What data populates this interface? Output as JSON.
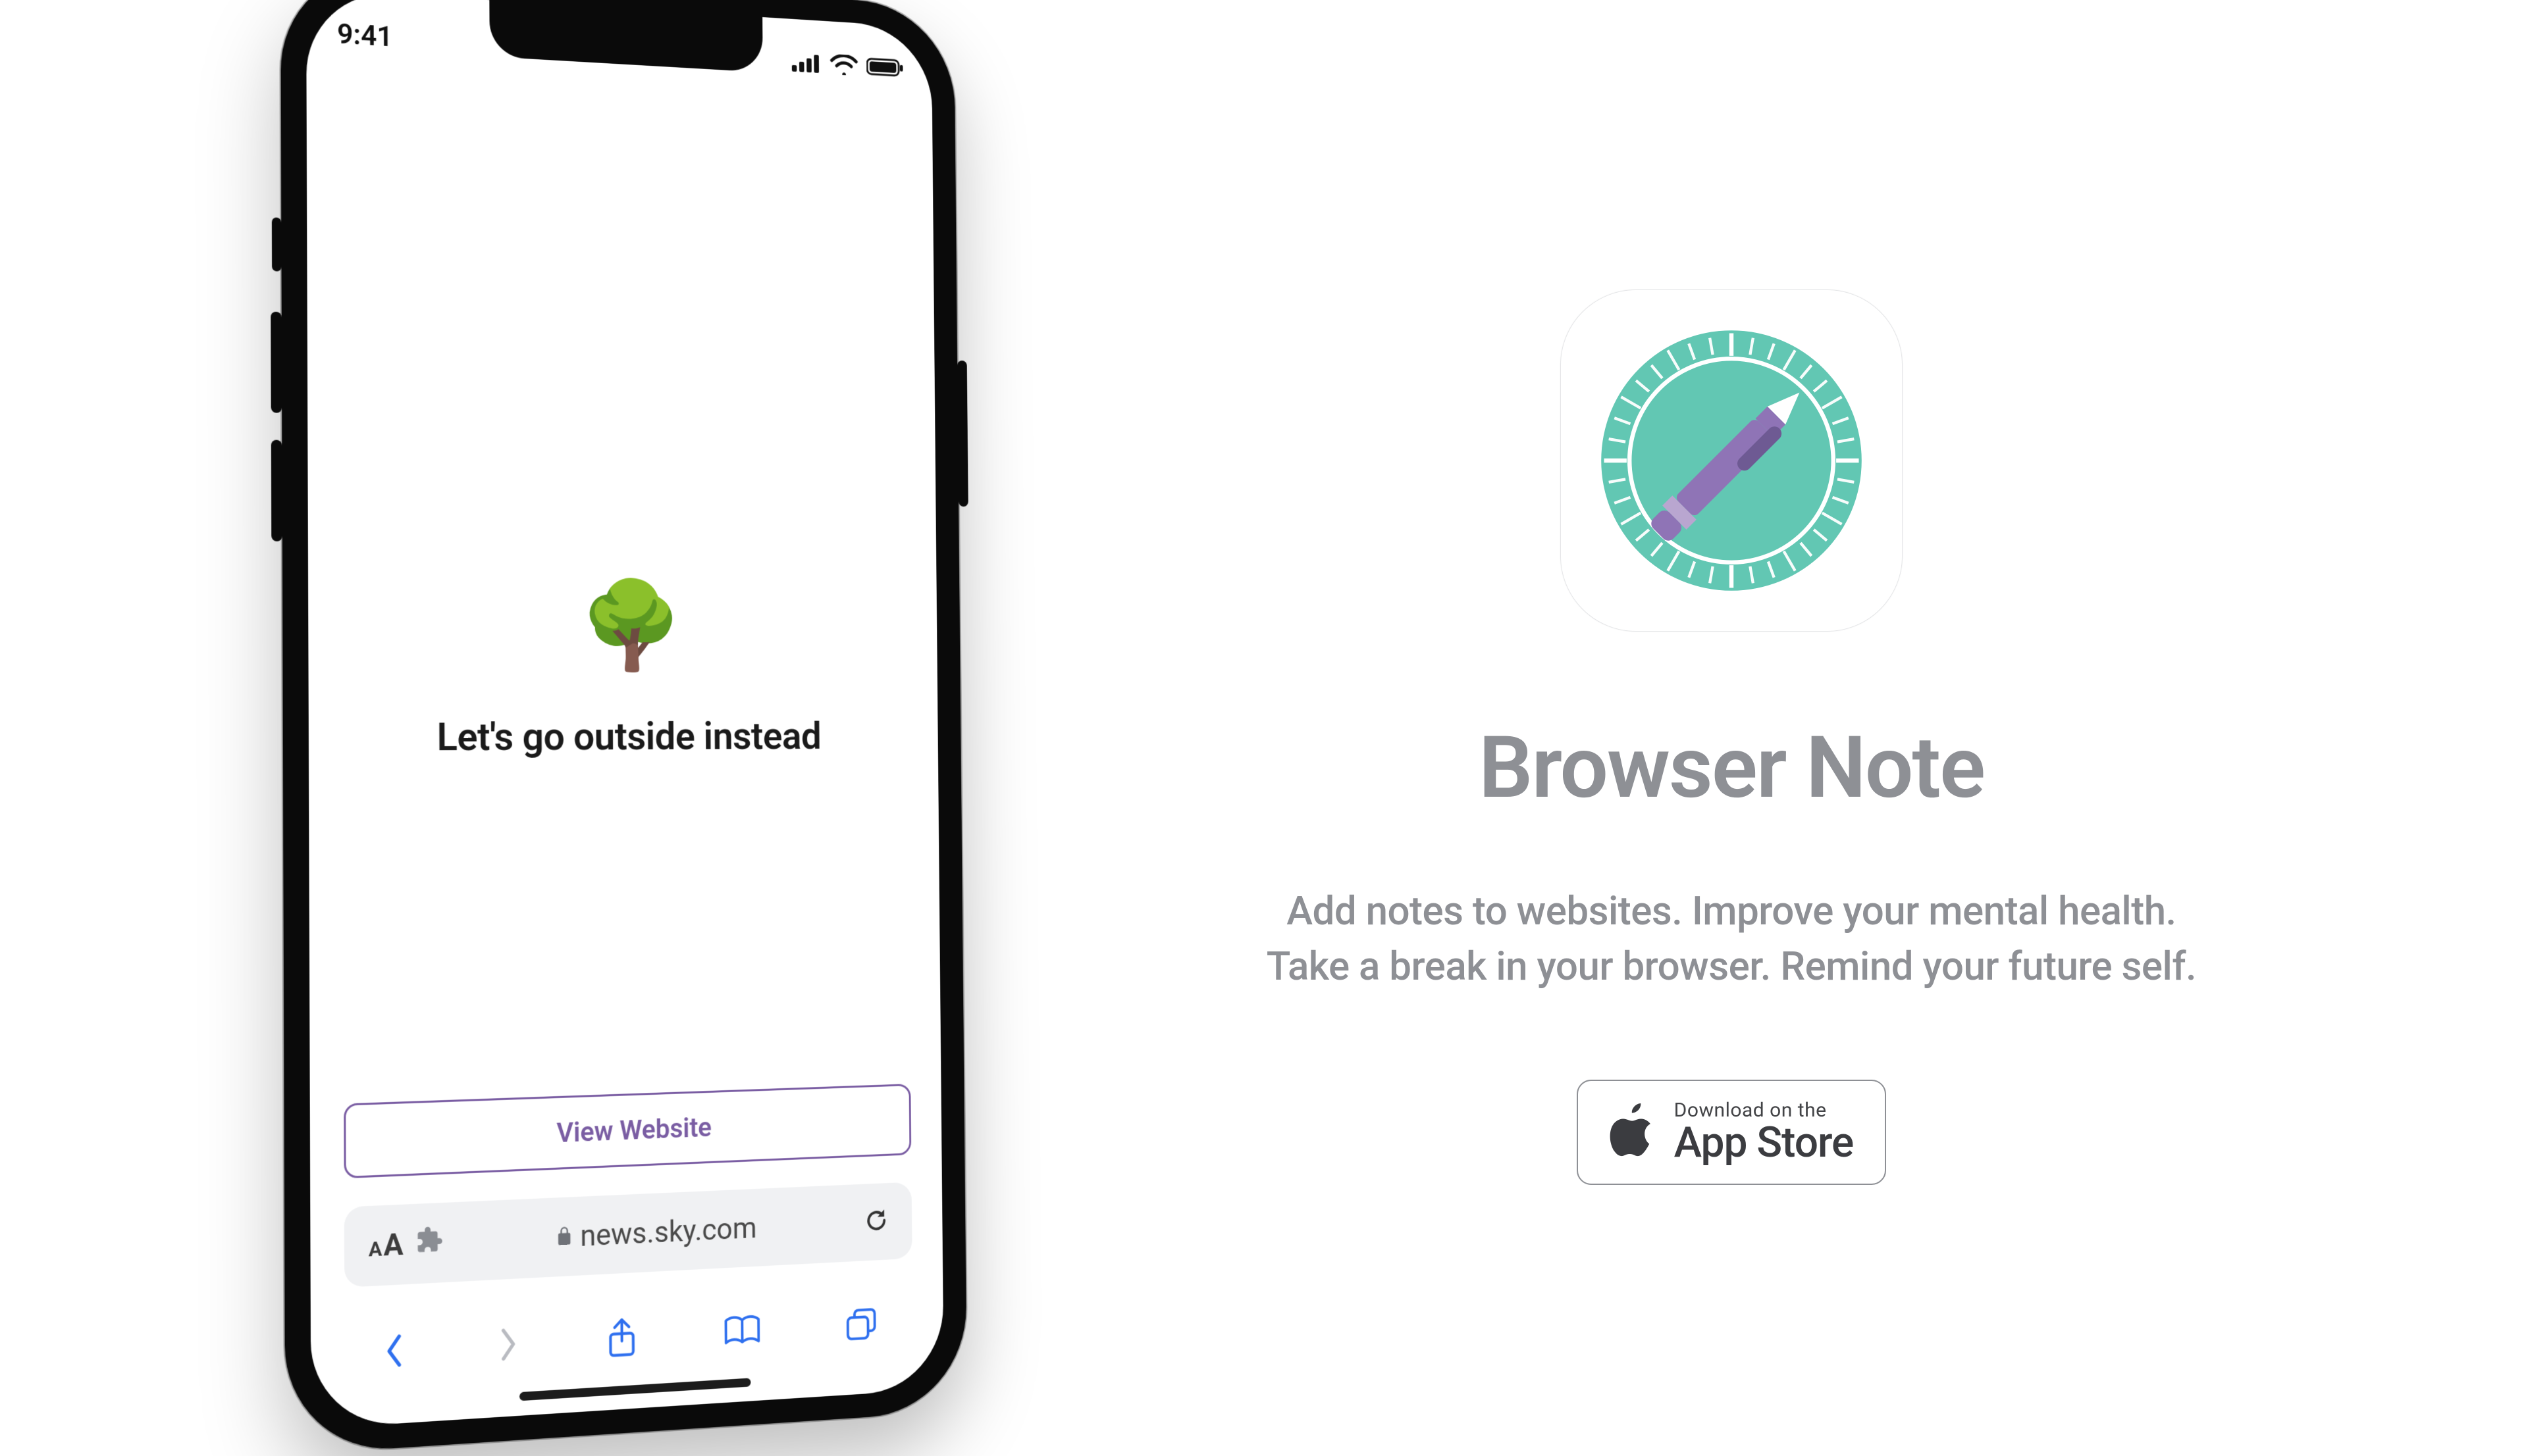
{
  "phone": {
    "status": {
      "time": "9:41"
    },
    "note": {
      "emoji": "🌳",
      "message": "Let's go outside instead",
      "view_button": "View Website"
    },
    "safari": {
      "domain": "news.sky.com"
    }
  },
  "marketing": {
    "title": "Browser Note",
    "tagline_line1": "Add notes to websites. Improve your mental health.",
    "tagline_line2": "Take a break in your browser. Remind your future self.",
    "badge_line1": "Download on the",
    "badge_line2": "App Store"
  },
  "colors": {
    "accent_purple": "#7a5da3",
    "brand_teal": "#62c7b3",
    "grey_text": "#8e9095"
  }
}
